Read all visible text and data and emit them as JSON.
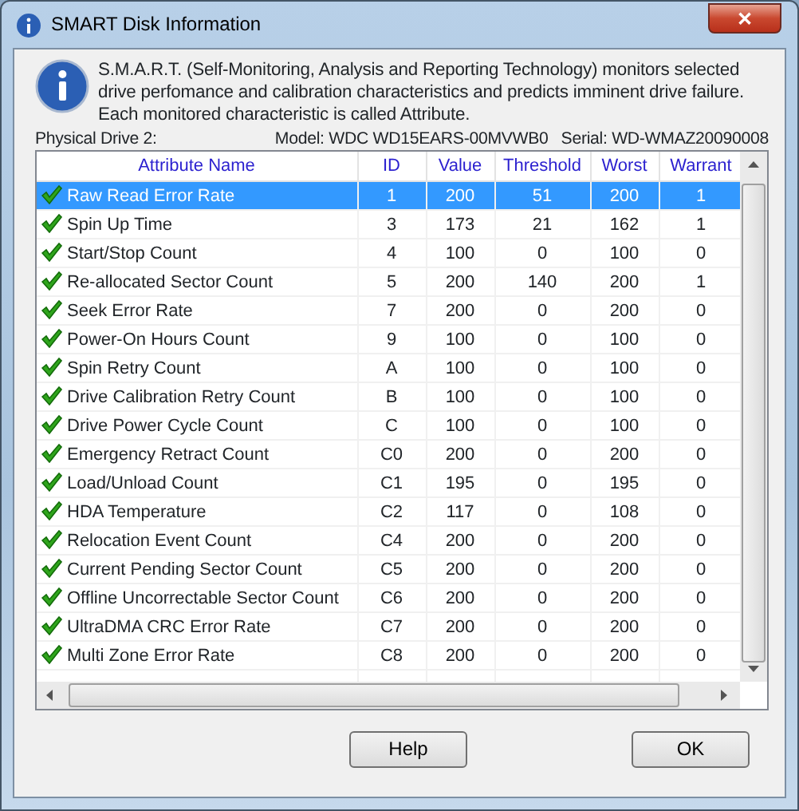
{
  "window": {
    "title": "SMART Disk Information",
    "close": "✕"
  },
  "description": "S.M.A.R.T. (Self-Monitoring, Analysis and Reporting Technology) monitors selected drive perfomance and calibration characteristics and predicts imminent drive failure. Each monitored characteristic is called Attribute.",
  "drive": {
    "label": "Physical Drive 2:",
    "model": "Model: WDC WD15EARS-00MVWB0",
    "serial": "Serial: WD-WMAZ20090008"
  },
  "table": {
    "columns": [
      "Attribute Name",
      "ID",
      "Value",
      "Threshold",
      "Worst",
      "Warrant"
    ],
    "rows": [
      {
        "cells": [
          "Raw Read Error Rate",
          "1",
          "200",
          "51",
          "200",
          "1"
        ],
        "selected": true
      },
      {
        "cells": [
          "Spin Up Time",
          "3",
          "173",
          "21",
          "162",
          "1"
        ],
        "selected": false
      },
      {
        "cells": [
          "Start/Stop Count",
          "4",
          "100",
          "0",
          "100",
          "0"
        ],
        "selected": false
      },
      {
        "cells": [
          "Re-allocated Sector Count",
          "5",
          "200",
          "140",
          "200",
          "1"
        ],
        "selected": false
      },
      {
        "cells": [
          "Seek Error Rate",
          "7",
          "200",
          "0",
          "200",
          "0"
        ],
        "selected": false
      },
      {
        "cells": [
          "Power-On Hours Count",
          "9",
          "100",
          "0",
          "100",
          "0"
        ],
        "selected": false
      },
      {
        "cells": [
          "Spin Retry Count",
          "A",
          "100",
          "0",
          "100",
          "0"
        ],
        "selected": false
      },
      {
        "cells": [
          "Drive Calibration Retry Count",
          "B",
          "100",
          "0",
          "100",
          "0"
        ],
        "selected": false
      },
      {
        "cells": [
          "Drive Power Cycle Count",
          "C",
          "100",
          "0",
          "100",
          "0"
        ],
        "selected": false
      },
      {
        "cells": [
          "Emergency Retract Count",
          "C0",
          "200",
          "0",
          "200",
          "0"
        ],
        "selected": false
      },
      {
        "cells": [
          "Load/Unload Count",
          "C1",
          "195",
          "0",
          "195",
          "0"
        ],
        "selected": false
      },
      {
        "cells": [
          "HDA Temperature",
          "C2",
          "117",
          "0",
          "108",
          "0"
        ],
        "selected": false
      },
      {
        "cells": [
          "Relocation Event Count",
          "C4",
          "200",
          "0",
          "200",
          "0"
        ],
        "selected": false
      },
      {
        "cells": [
          "Current Pending Sector Count",
          "C5",
          "200",
          "0",
          "200",
          "0"
        ],
        "selected": false
      },
      {
        "cells": [
          "Offline Uncorrectable Sector Count",
          "C6",
          "200",
          "0",
          "200",
          "0"
        ],
        "selected": false
      },
      {
        "cells": [
          "UltraDMA CRC Error Rate",
          "C7",
          "200",
          "0",
          "200",
          "0"
        ],
        "selected": false
      },
      {
        "cells": [
          "Multi Zone Error Rate",
          "C8",
          "200",
          "0",
          "200",
          "0"
        ],
        "selected": false
      }
    ]
  },
  "buttons": [
    "Help",
    "OK"
  ]
}
